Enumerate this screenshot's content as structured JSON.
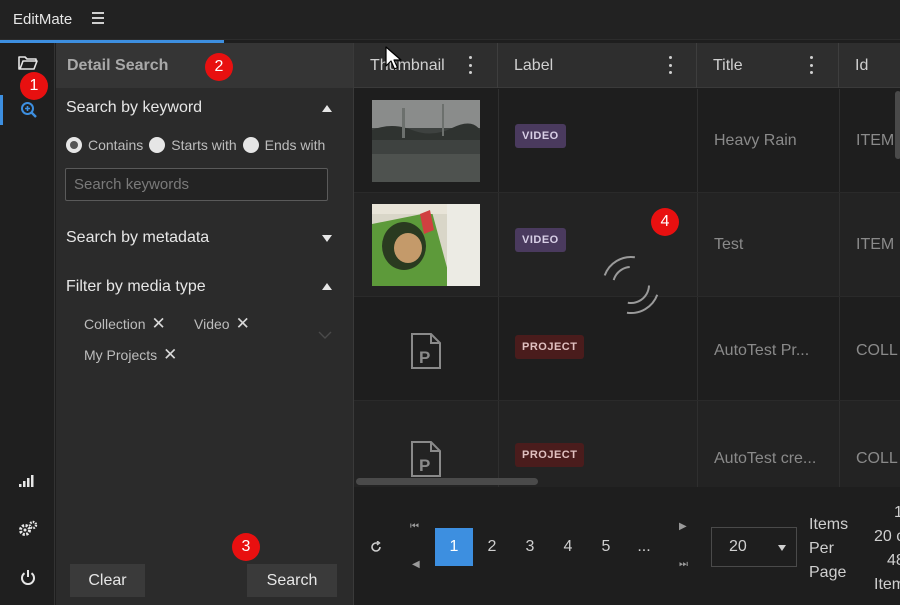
{
  "app": {
    "title": "EditMate",
    "menu_icon": "hamburger-icon"
  },
  "iconbar": {
    "items": [
      {
        "name": "folder-open-icon",
        "active": false
      },
      {
        "name": "zoom-search-icon",
        "active": true
      },
      {
        "name": "signal-bars-icon",
        "active": false
      },
      {
        "name": "gears-icon",
        "active": false
      },
      {
        "name": "power-icon",
        "active": false
      }
    ]
  },
  "search_panel": {
    "title": "Detail Search",
    "keyword_section": {
      "title": "Search by keyword",
      "expanded": true,
      "options": [
        "Contains",
        "Starts with",
        "Ends with"
      ],
      "selected_option": "Contains",
      "input_value": "",
      "input_placeholder": "Search keywords"
    },
    "metadata_section": {
      "title": "Search by metadata",
      "expanded": false
    },
    "media_type_section": {
      "title": "Filter by media type",
      "expanded": true,
      "chips": [
        "Collection",
        "Video",
        "My Projects"
      ]
    },
    "clear_label": "Clear",
    "search_label": "Search"
  },
  "grid": {
    "columns": [
      "Thumbnail",
      "Label",
      "Title",
      "Id"
    ],
    "rows": [
      {
        "thumbnail": "rain-video-thumbnail",
        "label": "VIDEO",
        "title": "Heavy Rain",
        "id": "ITEM"
      },
      {
        "thumbnail": "cartoon-video-thumbnail",
        "label": "VIDEO",
        "title": "Test",
        "id": "ITEM"
      },
      {
        "thumbnail": "project-file-icon",
        "label": "PROJECT",
        "title": "AutoTest Pr...",
        "id": "COLL"
      },
      {
        "thumbnail": "project-file-icon",
        "label": "PROJECT",
        "title": "AutoTest cre...",
        "id": "COLL"
      }
    ],
    "loading": true
  },
  "pagination": {
    "pages": [
      "1",
      "2",
      "3",
      "4",
      "5",
      "..."
    ],
    "current_page": "1",
    "per_page": "20",
    "per_page_label": "Items Per Page",
    "range_text": [
      "1",
      "20 c",
      "48",
      "Item"
    ]
  },
  "annotations": [
    "1",
    "2",
    "3",
    "4"
  ],
  "colors": {
    "accent": "#3d8fe0",
    "video_badge": "#4a3a5e",
    "project_badge": "#4a1c1c",
    "marker": "#e81010"
  }
}
